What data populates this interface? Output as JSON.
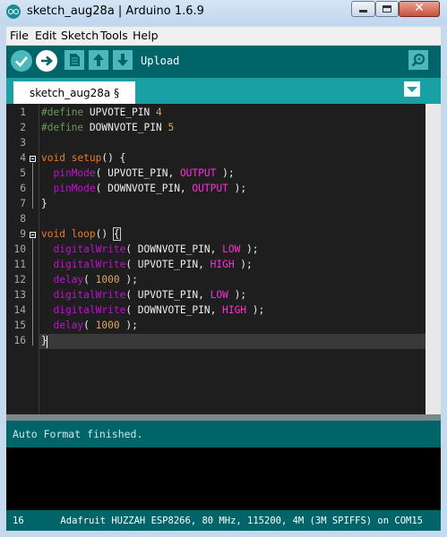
{
  "window": {
    "title": "sketch_aug28a | Arduino 1.6.9",
    "close_glyph": "✕"
  },
  "menu": {
    "items": [
      "File",
      "Edit",
      "Sketch",
      "Tools",
      "Help"
    ]
  },
  "toolbar": {
    "hover_label": "Upload",
    "buttons": [
      "verify-icon",
      "upload-icon",
      "new-icon",
      "open-icon",
      "save-icon",
      "serial-monitor-icon"
    ]
  },
  "tab": {
    "label": "sketch_aug28a §"
  },
  "editor": {
    "line_numbers": [
      "1",
      "2",
      "3",
      "4",
      "5",
      "6",
      "7",
      "8",
      "9",
      "10",
      "11",
      "12",
      "13",
      "14",
      "15",
      "16"
    ],
    "current_line": 16,
    "lines": [
      [
        [
          "pp",
          "#define"
        ],
        [
          "txt",
          " UPVOTE_PIN "
        ],
        [
          "num",
          "4"
        ]
      ],
      [
        [
          "pp",
          "#define"
        ],
        [
          "txt",
          " DOWNVOTE_PIN "
        ],
        [
          "num",
          "5"
        ]
      ],
      [],
      [
        [
          "kw",
          "void"
        ],
        [
          "txt",
          " "
        ],
        [
          "kw",
          "setup"
        ],
        [
          "txt",
          "() {"
        ]
      ],
      [
        [
          "txt",
          "  "
        ],
        [
          "fn",
          "pinMode"
        ],
        [
          "txt",
          "( UPVOTE_PIN, "
        ],
        [
          "cst",
          "OUTPUT"
        ],
        [
          "txt",
          " );"
        ]
      ],
      [
        [
          "txt",
          "  "
        ],
        [
          "fn",
          "pinMode"
        ],
        [
          "txt",
          "( DOWNVOTE_PIN, "
        ],
        [
          "cst",
          "OUTPUT"
        ],
        [
          "txt",
          " );"
        ]
      ],
      [
        [
          "txt",
          "}"
        ]
      ],
      [],
      [
        [
          "kw",
          "void"
        ],
        [
          "txt",
          " "
        ],
        [
          "kw",
          "loop"
        ],
        [
          "txt",
          "() "
        ],
        [
          "txt",
          "{"
        ]
      ],
      [
        [
          "txt",
          "  "
        ],
        [
          "fn",
          "digitalWrite"
        ],
        [
          "txt",
          "( DOWNVOTE_PIN, "
        ],
        [
          "cst",
          "LOW"
        ],
        [
          "txt",
          " );"
        ]
      ],
      [
        [
          "txt",
          "  "
        ],
        [
          "fn",
          "digitalWrite"
        ],
        [
          "txt",
          "( UPVOTE_PIN, "
        ],
        [
          "cst",
          "HIGH"
        ],
        [
          "txt",
          " );"
        ]
      ],
      [
        [
          "txt",
          "  "
        ],
        [
          "fn",
          "delay"
        ],
        [
          "txt",
          "( "
        ],
        [
          "num",
          "1000"
        ],
        [
          "txt",
          " );"
        ]
      ],
      [
        [
          "txt",
          "  "
        ],
        [
          "fn",
          "digitalWrite"
        ],
        [
          "txt",
          "( UPVOTE_PIN, "
        ],
        [
          "cst",
          "LOW"
        ],
        [
          "txt",
          " );"
        ]
      ],
      [
        [
          "txt",
          "  "
        ],
        [
          "fn",
          "digitalWrite"
        ],
        [
          "txt",
          "( DOWNVOTE_PIN, "
        ],
        [
          "cst",
          "HIGH"
        ],
        [
          "txt",
          " );"
        ]
      ],
      [
        [
          "txt",
          "  "
        ],
        [
          "fn",
          "delay"
        ],
        [
          "txt",
          "( "
        ],
        [
          "num",
          "1000"
        ],
        [
          "txt",
          " );"
        ]
      ],
      [
        [
          "txt",
          "}"
        ]
      ]
    ]
  },
  "status": {
    "message": "Auto Format finished."
  },
  "footer": {
    "line_number": "16",
    "board": "Adafruit HUZZAH ESP8266, 80 MHz, 115200, 4M (3M SPIFFS) on COM15"
  },
  "colors": {
    "toolbar_bg": "#006468",
    "tab_bar_bg": "#17a1a5",
    "editor_bg": "#1e1e1e",
    "keyword": "#ea7a2a",
    "function": "#c40fd0",
    "constant": "#ff2fd6",
    "preprocessor": "#6a9955"
  }
}
